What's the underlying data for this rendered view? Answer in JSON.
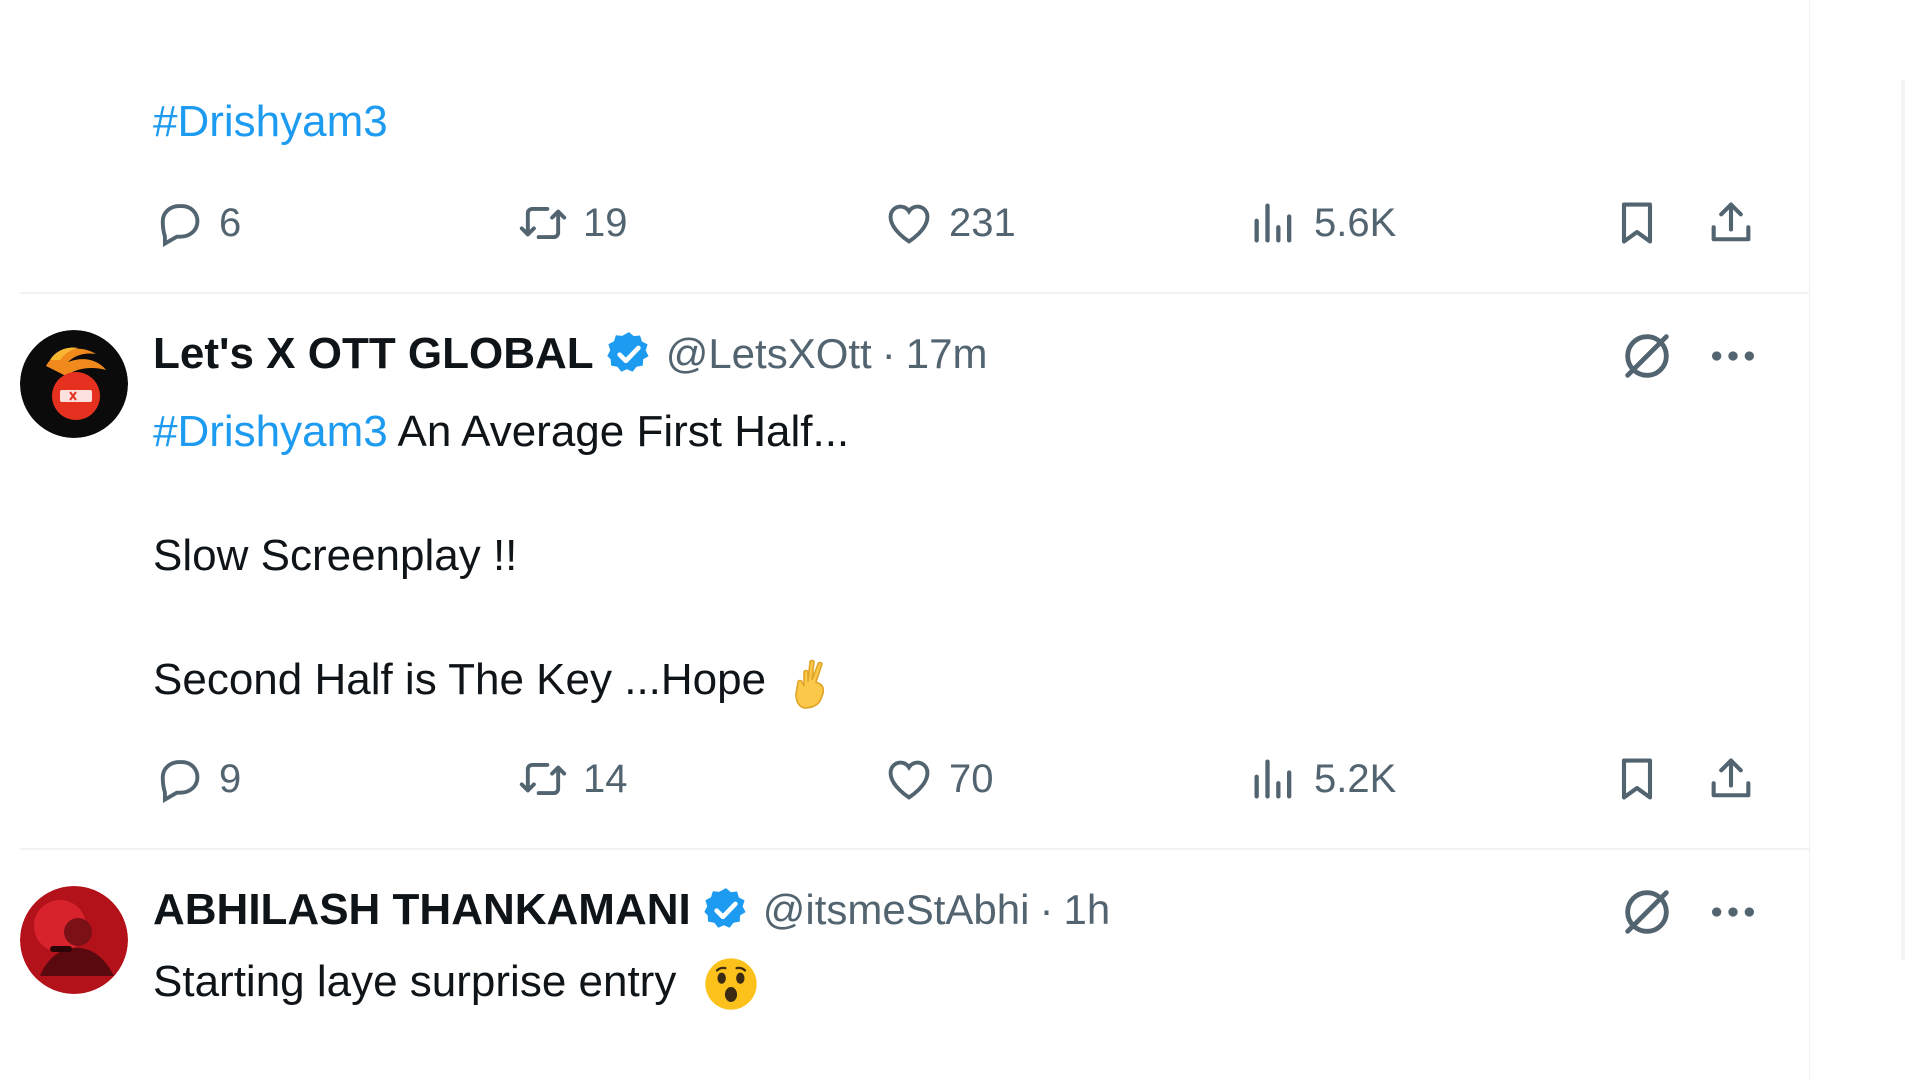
{
  "tweet1": {
    "hashtag": "#Drishyam3",
    "stats": {
      "replies": "6",
      "retweets": "19",
      "likes": "231",
      "views": "5.6K"
    }
  },
  "tweet2": {
    "name": "Let's X OTT GLOBAL",
    "handle": "@LetsXOtt",
    "separator": "·",
    "time": "17m",
    "hashtag": "#Drishyam3",
    "line1_rest": " An Average First Half...",
    "line2": "Slow Screenplay !!",
    "line3": "Second Half is The Key ...Hope",
    "line3_emoji": "crossed-fingers",
    "stats": {
      "replies": "9",
      "retweets": "14",
      "likes": "70",
      "views": "5.2K"
    }
  },
  "tweet3": {
    "name": "ABHILASH THANKAMANI",
    "handle": "@itsmeStAbhi",
    "separator": "·",
    "time": "1h",
    "line1": "Starting laye surprise entry",
    "line1_emoji": "astonished-face"
  },
  "colors": {
    "accent": "#1d9bf0",
    "text": "#0f1419",
    "muted": "#536471",
    "divider": "#eff3f4"
  }
}
